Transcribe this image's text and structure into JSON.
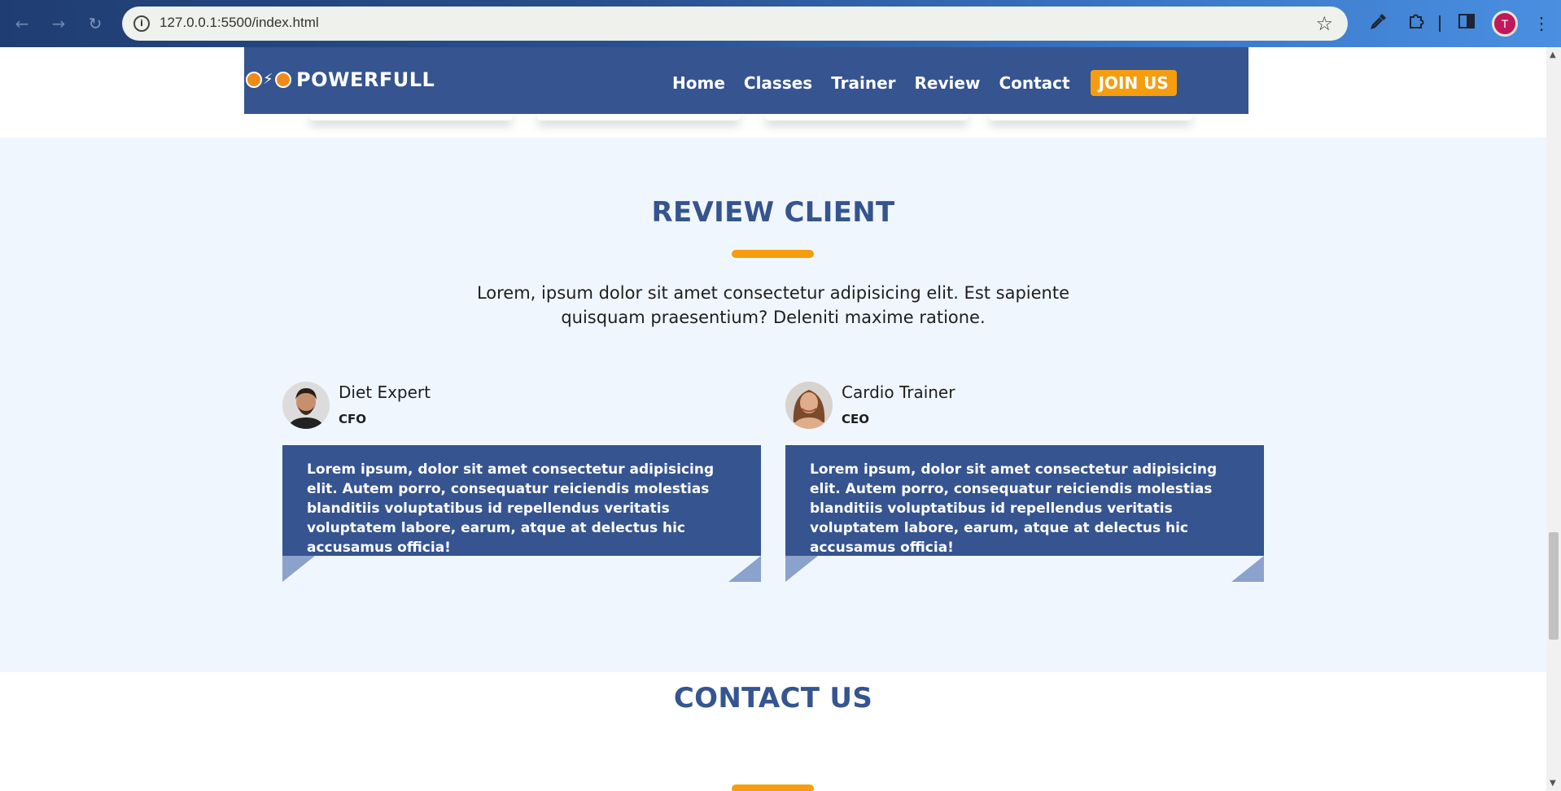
{
  "browser": {
    "url": "127.0.0.1:5500/index.html",
    "profile_initial": "T",
    "icons": {
      "back": "back-arrow-icon",
      "forward": "forward-arrow-icon",
      "reload": "reload-icon",
      "site_info": "info-icon",
      "bookmark": "star-icon",
      "eyedropper": "eyedropper-icon",
      "extensions": "puzzle-icon",
      "side_panel": "side-panel-icon",
      "menu": "kebab-menu-icon"
    }
  },
  "header": {
    "brand": "POWERFULL",
    "menu": [
      "Home",
      "Classes",
      "Trainer",
      "Review",
      "Contact"
    ],
    "cta": "JOIN US"
  },
  "review": {
    "title": "REVIEW CLIENT",
    "intro": "Lorem, ipsum dolor sit amet consectetur adipisicing elit. Est sapiente quisquam praesentium? Deleniti maxime ratione.",
    "cards": [
      {
        "name": "Diet Expert",
        "role": "CFO",
        "quote": "Lorem ipsum, dolor sit amet consectetur adipisicing elit. Autem porro, consequatur reiciendis molestias blanditiis voluptatibus id repellendus veritatis voluptatem labore, earum, atque at delectus hic accusamus officia!"
      },
      {
        "name": "Cardio Trainer",
        "role": "CEO",
        "quote": "Lorem ipsum, dolor sit amet consectetur adipisicing elit. Autem porro, consequatur reiciendis molestias blanditiis voluptatibus id repellendus veritatis voluptatem labore, earum, atque at delectus hic accusamus officia!"
      }
    ]
  },
  "contact": {
    "title": "CONTACT US"
  },
  "colors": {
    "primary": "#355490",
    "accent": "#f59d0f",
    "section_bg": "#f0f6fe",
    "fold": "#8aa2cc"
  }
}
